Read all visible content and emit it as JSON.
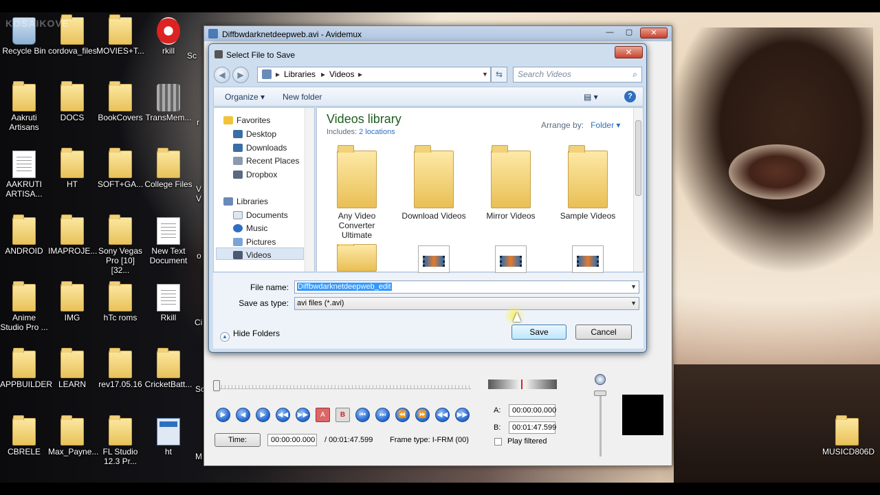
{
  "desktop": {
    "icons": [
      {
        "label": "Recycle Bin",
        "type": "bin"
      },
      {
        "label": "cordova_files",
        "type": "folder"
      },
      {
        "label": "MOVIES+T...",
        "type": "folder"
      },
      {
        "label": "rkill",
        "type": "rkill"
      },
      {
        "label": "Aakruti Artisans",
        "type": "folder"
      },
      {
        "label": "DOCS",
        "type": "folder"
      },
      {
        "label": "BookCovers",
        "type": "folder"
      },
      {
        "label": "TransMem...",
        "type": "tool"
      },
      {
        "label": "AAKRUTI ARTISA...",
        "type": "doc"
      },
      {
        "label": "HT",
        "type": "folder"
      },
      {
        "label": "SOFT+GA...",
        "type": "folder"
      },
      {
        "label": "College Files",
        "type": "folder"
      },
      {
        "label": "ANDROID",
        "type": "folder"
      },
      {
        "label": "IMAPROJE...",
        "type": "folder"
      },
      {
        "label": "Sony Vegas Pro [10] [32...",
        "type": "folder"
      },
      {
        "label": "New Text Document",
        "type": "doc"
      },
      {
        "label": "Anime Studio Pro ...",
        "type": "folder"
      },
      {
        "label": "IMG",
        "type": "folder"
      },
      {
        "label": "hTc roms",
        "type": "folder"
      },
      {
        "label": "Rkill",
        "type": "doc"
      },
      {
        "label": "APPBUILDER",
        "type": "folder"
      },
      {
        "label": "LEARN",
        "type": "folder"
      },
      {
        "label": "rev17.05.16",
        "type": "folder"
      },
      {
        "label": "CricketBatt...",
        "type": "folder"
      },
      {
        "label": "CBRELE",
        "type": "folder"
      },
      {
        "label": "Max_Payne...",
        "type": "folder"
      },
      {
        "label": "FL Studio 12.3 Pr...",
        "type": "folder"
      },
      {
        "label": "ht",
        "type": "ht"
      }
    ],
    "partial_labels": [
      "Sc",
      "r",
      "V V",
      "o",
      "Ci",
      "Sc",
      "M"
    ],
    "right_icon": "MUSICD806D",
    "watermark": "KOSAIKOVE"
  },
  "avidemux": {
    "title": "Diffbwdarknetdeepweb.avi - Avidemux",
    "minimize": "—",
    "maximize": "▢",
    "close": "✕",
    "time_button": "Time:",
    "time_value": "00:00:00.000",
    "duration": "/ 00:01:47.599",
    "frame_type": "Frame type:  I-FRM (00)",
    "a_label": "A:",
    "a_value": "00:00:00.000",
    "b_label": "B:",
    "b_value": "00:01:47.599",
    "play_filtered": "Play filtered",
    "controls": [
      "▶",
      "◀",
      "▶",
      "◀◀",
      "▶▶",
      "A",
      "B",
      "⏮",
      "⏭",
      "⏪",
      "⏩",
      "◀◀",
      "▶▶"
    ]
  },
  "dialog": {
    "title": "Select File to Save",
    "close": "✕",
    "breadcrumb": [
      "Libraries",
      "Videos"
    ],
    "search_placeholder": "Search Videos",
    "organize": "Organize ▾",
    "new_folder": "New folder",
    "help": "?",
    "tree": {
      "favorites_label": "Favorites",
      "favorites": [
        "Desktop",
        "Downloads",
        "Recent Places",
        "Dropbox"
      ],
      "libraries_label": "Libraries",
      "libraries": [
        "Documents",
        "Music",
        "Pictures",
        "Videos"
      ]
    },
    "library_title": "Videos library",
    "includes_label": "Includes:",
    "includes_link": "2 locations",
    "arrange_by_label": "Arrange by:",
    "arrange_by_value": "Folder ▾",
    "items": [
      "Any Video Converter Ultimate",
      "Download Videos",
      "Mirror Videos",
      "Sample Videos"
    ],
    "file_name_label": "File name:",
    "file_name_value": "Diffbwdarknetdeepweb_edit",
    "save_as_type_label": "Save as type:",
    "save_as_type_value": "avi files (*.avi)",
    "hide_folders": "Hide Folders",
    "save_button": "Save",
    "cancel_button": "Cancel"
  }
}
